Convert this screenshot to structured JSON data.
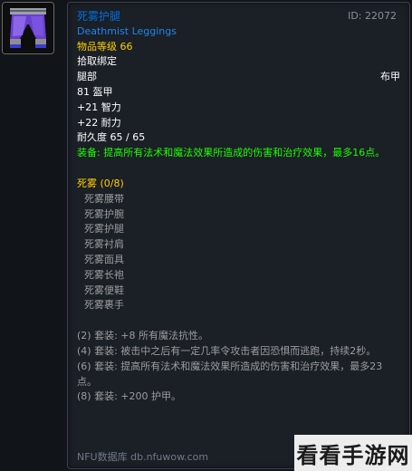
{
  "item": {
    "name_cn": "死雾护腿",
    "name_en": "Deathmist Leggings",
    "id_label": "ID: 22072",
    "item_level": "物品等级 66",
    "bind": "拾取绑定",
    "slot": "腿部",
    "armor_type": "布甲",
    "armor": "81 盔甲",
    "stat_int": "+21 智力",
    "stat_sta": "+22 耐力",
    "durability": "耐久度 65 / 65",
    "equip_effect": "装备: 提高所有法术和魔法效果所造成的伤害和治疗效果，最多16点。"
  },
  "set": {
    "title": "死雾 (0/8)",
    "pieces": [
      "死雾腰带",
      "死雾护腕",
      "死雾护腿",
      "死雾衬肩",
      "死雾面具",
      "死雾长袍",
      "死雾便鞋",
      "死雾裹手"
    ],
    "bonuses": [
      "(2) 套装: +8 所有魔法抗性。",
      "(4) 套装: 被击中之后有一定几率令攻击者因恐惧而逃跑，持续2秒。",
      "(6) 套装: 提高所有法术和魔法效果所造成的伤害和治疗效果，最多23点。",
      "(8) 套装: +200 护甲。"
    ]
  },
  "footer": "NFU数据库 db.nfuwow.com",
  "watermark": "看看手游网",
  "colors": {
    "epic_blue": "#0070dd",
    "gold": "#ffd100",
    "green": "#1eff00",
    "grey": "#9d9d9d"
  },
  "icon": "purple-leggings-icon"
}
